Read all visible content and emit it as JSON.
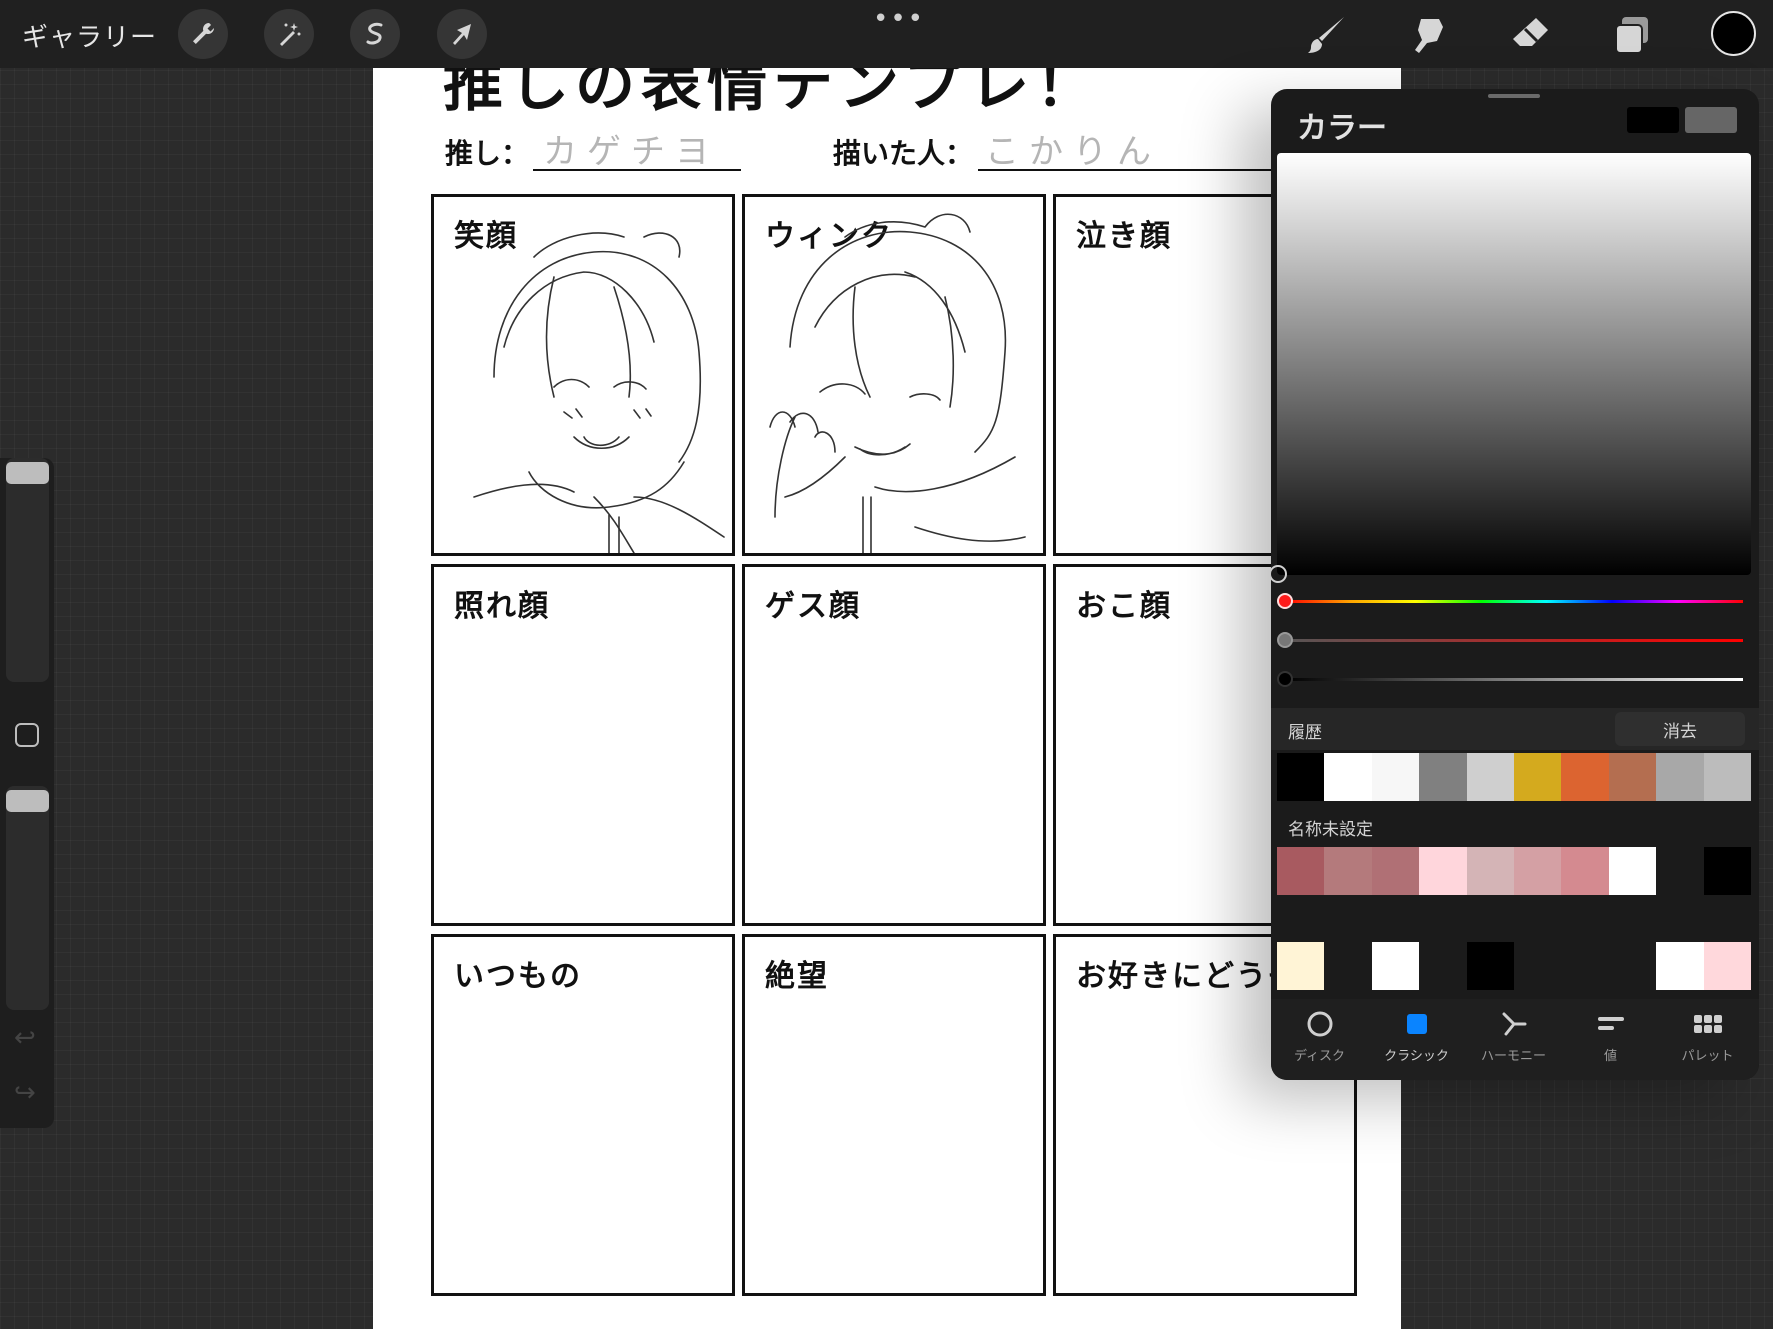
{
  "toolbar": {
    "gallery_label": "ギャラリー",
    "more_label": "•••",
    "left_tools": [
      "wrench-icon",
      "magic-wand-icon",
      "selection-icon",
      "transform-arrow-icon"
    ],
    "right_tools": [
      "brush-icon",
      "smudge-icon",
      "eraser-icon",
      "layers-icon"
    ],
    "current_color": "#000000"
  },
  "canvas": {
    "title": "推しの表情テンプレ！",
    "oshi_label": "推し：",
    "oshi_value": "カゲチヨ",
    "artist_label": "描いた人：",
    "artist_value": "こかりん",
    "cells": [
      {
        "label": "笑顔"
      },
      {
        "label": "ウィンク"
      },
      {
        "label": "泣き顔"
      },
      {
        "label": "照れ顔"
      },
      {
        "label": "ゲス顔"
      },
      {
        "label": "おこ顔"
      },
      {
        "label": "いつもの"
      },
      {
        "label": "絶望"
      },
      {
        "label": "お好きにどうぞ"
      }
    ]
  },
  "color_panel": {
    "title": "カラー",
    "current_swatch": "#000000",
    "previous_swatch": "#666666",
    "history_label": "履歴",
    "clear_label": "消去",
    "history_colors": [
      "#000000",
      "#ffffff",
      "#f7f7f7",
      "#808080",
      "#cfcfcf",
      "#d4aa1e",
      "#dc6430",
      "#b46e50",
      "#a8a8a8",
      "#bcbcbc"
    ],
    "palette_name": "名称未設定",
    "palette_row1": [
      "#a85a60",
      "#b47a7c",
      "#b07075",
      "#ffd6dc",
      "#d4b4b6",
      "#d4a0a4",
      "#d48a90",
      "#ffffff",
      "#1b1b1b",
      "#000000"
    ],
    "palette_row2": [
      "#1b1b1b",
      "#1b1b1b",
      "#1b1b1b",
      "#1b1b1b",
      "#1b1b1b",
      "#1b1b1b",
      "#1b1b1b",
      "#1b1b1b",
      "#1b1b1b",
      "#1b1b1b"
    ],
    "palette_row3": [
      "#fff4d6",
      "#1b1b1b",
      "#ffffff",
      "#1b1b1b",
      "#000000",
      "#1b1b1b",
      "#1b1b1b",
      "#1b1b1b",
      "#ffffff",
      "#ffd8dc"
    ],
    "tabs": [
      {
        "label": "ディスク",
        "icon": "disc-icon"
      },
      {
        "label": "クラシック",
        "icon": "classic-icon"
      },
      {
        "label": "ハーモニー",
        "icon": "harmony-icon"
      },
      {
        "label": "値",
        "icon": "value-icon"
      },
      {
        "label": "パレット",
        "icon": "palette-icon"
      }
    ],
    "active_tab": "クラシック",
    "accent": "#0a84ff"
  }
}
